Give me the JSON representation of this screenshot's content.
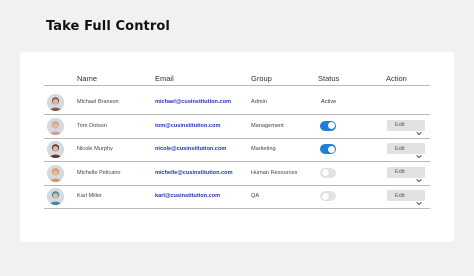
{
  "page": {
    "title": "Take Full Control"
  },
  "table": {
    "columns": [
      "Name",
      "Email",
      "Group",
      "Status",
      "Action"
    ],
    "rows": [
      {
        "name": "Michael Branson",
        "email": "michael@cusinstitution.com",
        "group": "Admin",
        "status": "Active",
        "active": true,
        "action": "",
        "avatar_color": "#7a5a48"
      },
      {
        "name": "Tom Dotson",
        "email": "tom@cusinstitution.com",
        "group": "Management",
        "status": "",
        "active": true,
        "action": "Edit",
        "avatar_color": "#c8a38a"
      },
      {
        "name": "Nicole Murphy",
        "email": "nicole@cusinstitution.com",
        "group": "Marketing",
        "status": "",
        "active": true,
        "action": "Edit",
        "avatar_color": "#5b3a2e"
      },
      {
        "name": "Michelle Pelicano",
        "email": "michelle@cusinstitution.com",
        "group": "Human Resources",
        "status": "",
        "active": false,
        "action": "Edit",
        "avatar_color": "#d99360"
      },
      {
        "name": "Karl Miller",
        "email": "karl@cusinstitution.com",
        "group": "QA",
        "status": "",
        "active": false,
        "action": "Edit",
        "avatar_color": "#3d8aa3"
      }
    ]
  },
  "colors": {
    "toggle_on": "#1e7fd9",
    "toggle_off": "#e3e3e6",
    "email_link": "#2333b8"
  },
  "icons": {
    "dropdown": "chevron-down-icon",
    "avatar": "user-avatar"
  }
}
